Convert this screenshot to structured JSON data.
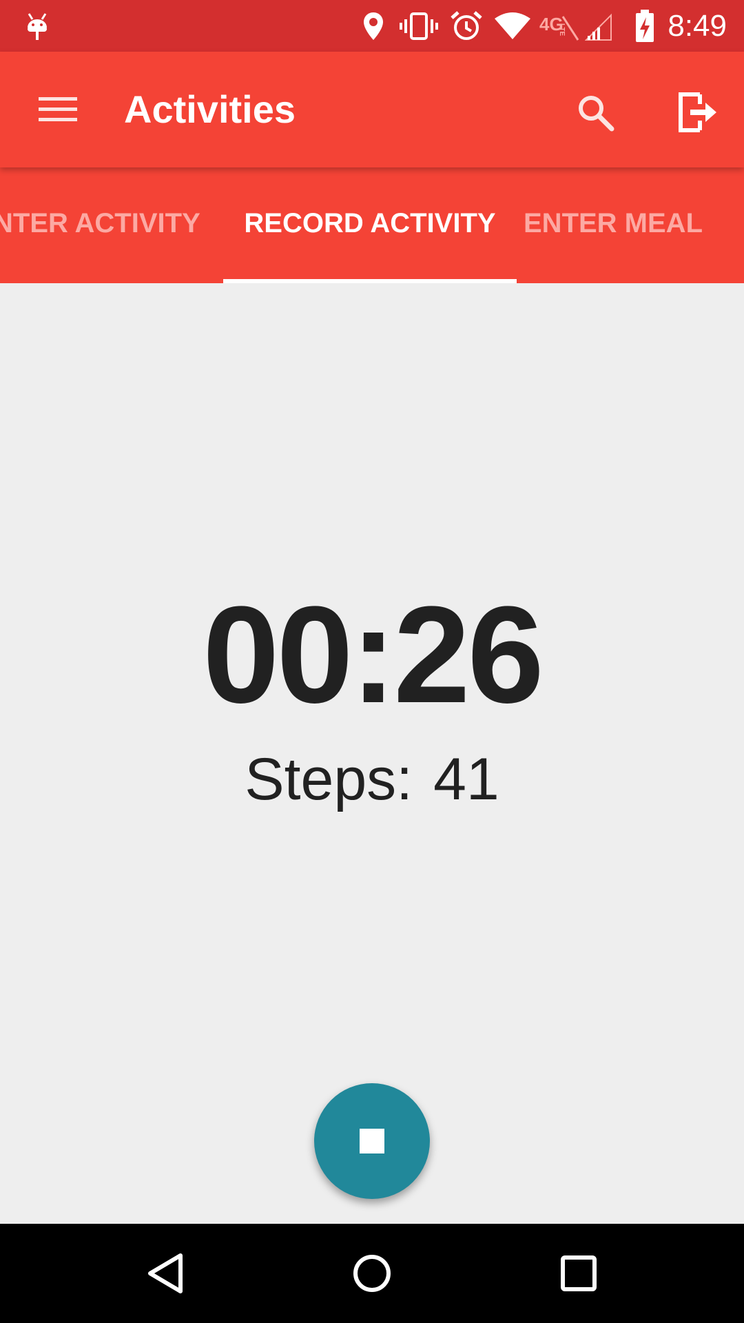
{
  "status_bar": {
    "time": "8:49",
    "icons": [
      "android-debug-icon",
      "location-pin-icon",
      "vibrate-icon",
      "alarm-icon",
      "wifi-icon",
      "4g-lte-icon",
      "signal-icon",
      "battery-charging-icon"
    ]
  },
  "app_bar": {
    "title": "Activities",
    "menu_icon": "hamburger-menu-icon",
    "search_icon": "search-icon",
    "logout_icon": "logout-icon"
  },
  "tabs": [
    {
      "label": "NTER ACTIVITY",
      "active": false
    },
    {
      "label": "RECORD ACTIVITY",
      "active": true
    },
    {
      "label": "ENTER MEAL",
      "active": false
    }
  ],
  "recording": {
    "timer": "00:26",
    "steps_label": "Steps:",
    "steps_value": "41"
  },
  "fab": {
    "icon": "stop-icon"
  },
  "nav_bar": {
    "buttons": [
      "back-icon",
      "home-icon",
      "recents-icon"
    ]
  },
  "colors": {
    "status_bar": "#d32f2f",
    "app_bar": "#f44336",
    "inactive_tab": "#fca9a3",
    "fab": "#21889a",
    "background": "#eeeeee"
  }
}
